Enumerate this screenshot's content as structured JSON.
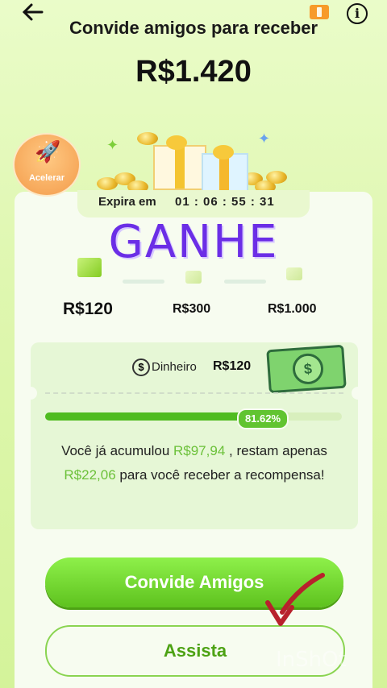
{
  "header": {
    "back_icon": "arrow-left-icon",
    "title": "Convide amigos para receber",
    "amount": "R$1.420",
    "info_icon": "info-icon",
    "ticket_icon": "ticket-icon"
  },
  "boost": {
    "label": "Acelerar",
    "icon": "rocket-icon"
  },
  "timer": {
    "label": "Expira em",
    "value": "01 : 06 : 55 : 31"
  },
  "overlay_text": "GANHE",
  "milestones": [
    {
      "label": "R$120",
      "active": true
    },
    {
      "label": "R$300",
      "active": false
    },
    {
      "label": "R$1.000",
      "active": false
    }
  ],
  "reward": {
    "type_icon": "dollar-circle-icon",
    "type_label": "Dinheiro",
    "value": "R$120",
    "progress_percent": 81.62,
    "progress_label": "81.62%",
    "message_part1": "Você já acumulou ",
    "accumulated": "R$97,94",
    "message_part2": " , restam apenas ",
    "remaining": "R$22,06",
    "message_part3": " para você receber a recompensa!"
  },
  "buttons": {
    "invite": "Convide Amigos",
    "watch": "Assista"
  },
  "watermark": "InShOt",
  "colors": {
    "primary_green": "#5ec21e",
    "highlight_green": "#6cc13a",
    "overlay_purple": "#6b2ee6",
    "arrow_red": "#b8212c"
  }
}
